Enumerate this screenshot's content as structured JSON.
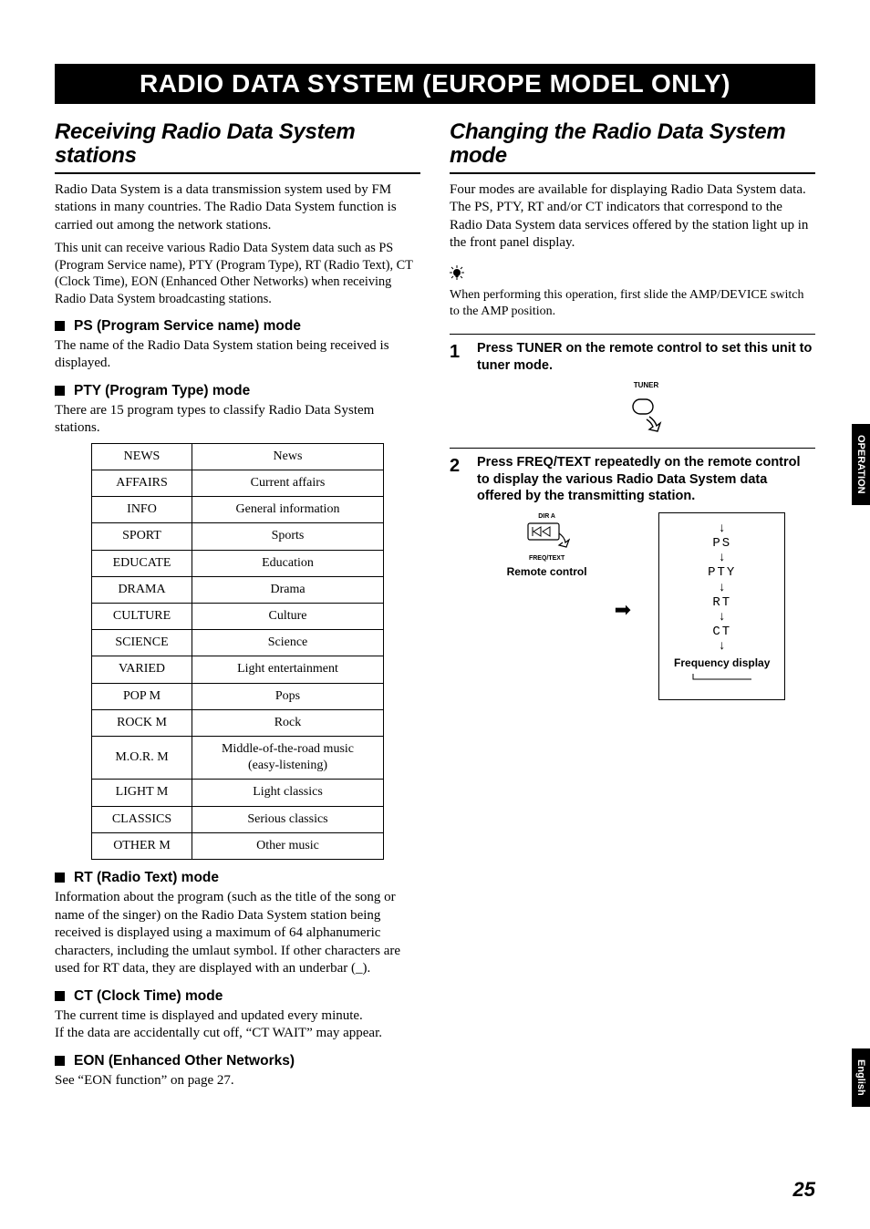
{
  "banner": "RADIO DATA SYSTEM (EUROPE MODEL ONLY)",
  "left": {
    "heading": "Receiving Radio Data System stations",
    "p1": "Radio Data System is a data transmission system used by FM stations in many countries. The Radio Data System function is carried out among the network stations.",
    "p2": "This unit can receive various Radio Data System data such as PS (Program Service name), PTY (Program Type), RT (Radio Text), CT (Clock Time), EON (Enhanced Other Networks) when receiving Radio Data System broadcasting stations.",
    "ps": {
      "title": "PS (Program Service name) mode",
      "text": "The name of the Radio Data System station being received is displayed."
    },
    "pty": {
      "title": "PTY (Program Type) mode",
      "text": "There are 15 program types to classify Radio Data System stations."
    },
    "table": [
      {
        "code": "NEWS",
        "desc": "News"
      },
      {
        "code": "AFFAIRS",
        "desc": "Current affairs"
      },
      {
        "code": "INFO",
        "desc": "General information"
      },
      {
        "code": "SPORT",
        "desc": "Sports"
      },
      {
        "code": "EDUCATE",
        "desc": "Education"
      },
      {
        "code": "DRAMA",
        "desc": "Drama"
      },
      {
        "code": "CULTURE",
        "desc": "Culture"
      },
      {
        "code": "SCIENCE",
        "desc": "Science"
      },
      {
        "code": "VARIED",
        "desc": "Light entertainment"
      },
      {
        "code": "POP M",
        "desc": "Pops"
      },
      {
        "code": "ROCK M",
        "desc": "Rock"
      },
      {
        "code": "M.O.R. M",
        "desc": "Middle-of-the-road music (easy-listening)"
      },
      {
        "code": "LIGHT M",
        "desc": "Light classics"
      },
      {
        "code": "CLASSICS",
        "desc": "Serious classics"
      },
      {
        "code": "OTHER M",
        "desc": "Other music"
      }
    ],
    "rt": {
      "title": "RT (Radio Text) mode",
      "text": "Information about the program (such as the title of the song or name of the singer) on the Radio Data System station being received is displayed using a maximum of 64 alphanumeric characters, including the umlaut symbol. If other characters are used for RT data, they are displayed with an underbar (_)."
    },
    "ct": {
      "title": "CT (Clock Time) mode",
      "text1": "The current time is displayed and updated every minute.",
      "text2": "If the data are accidentally cut off, “CT WAIT” may appear."
    },
    "eon": {
      "title": "EON (Enhanced Other Networks)",
      "text": "See “EON function” on page 27."
    }
  },
  "right": {
    "heading": "Changing the Radio Data System mode",
    "p1": "Four modes are available for displaying Radio Data System data. The PS, PTY, RT and/or CT indicators that correspond to the Radio Data System data services offered by the station light up in the front panel display.",
    "note": "When performing this operation, first slide the AMP/DEVICE switch to the AMP position.",
    "step1": {
      "num": "1",
      "text": "Press TUNER on the remote control to set this unit to tuner mode.",
      "btn_label": "TUNER"
    },
    "step2": {
      "num": "2",
      "text": "Press FREQ/TEXT repeatedly on the remote control to display the various Radio Data System data offered by the transmitting station.",
      "dir_a": "DIR A",
      "freq_text": "FREQ/TEXT",
      "remote_caption": "Remote control",
      "seq": [
        "PS",
        "PTY",
        "RT",
        "CT"
      ],
      "freq_display": "Frequency display"
    }
  },
  "side": {
    "operation": "OPERATION",
    "english": "English"
  },
  "page_number": "25"
}
